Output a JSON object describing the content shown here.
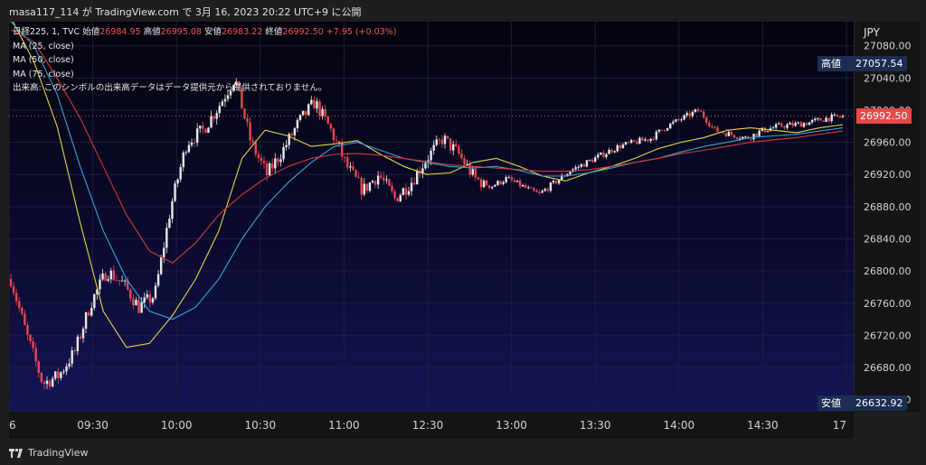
{
  "header": {
    "text": "masa117_114 が TradingView.com で 3月 16, 2023 20:22 UTC+9 に公開"
  },
  "legend": {
    "symbol": "日経225, 1, TVC",
    "open_label": "始値",
    "open_value": "26984.95",
    "high_label": "高値",
    "high_value": "26995.08",
    "low_label": "安値",
    "low_value": "26983.22",
    "close_label": "終値",
    "close_value": "26992.50",
    "change": "+7.95 (+0.03%)",
    "ma25": "MA (25, close)",
    "ma50": "MA (50, close)",
    "ma75": "MA (75, close)",
    "volume_note": "出来高: このシンボルの出来高データはデータ提供元から提供されておりません。"
  },
  "axis": {
    "currency": "JPY",
    "high_tag_label": "高値",
    "high_tag_value": "27057.54",
    "last_price": "26992.50",
    "low_tag_label": "安値",
    "low_tag_value": "26632.92"
  },
  "footer": {
    "brand": "TradingView"
  },
  "colors": {
    "up": "#e8e8e8",
    "down": "#e8484b",
    "ma25": "#e6d34a",
    "ma50": "#35a6d6",
    "ma75": "#d13a3a",
    "last_price_bg": "#e8484b",
    "tag_bg": "#1c2d52"
  },
  "chart_data": {
    "type": "candlestick",
    "yticks": [
      26640,
      26680,
      26720,
      26760,
      26800,
      26840,
      26880,
      26920,
      26960,
      27000,
      27040,
      27080
    ],
    "ylim": [
      26625,
      27110
    ],
    "xticks": [
      "6",
      "09:30",
      "10:00",
      "10:30",
      "11:00",
      "12:30",
      "13:00",
      "13:30",
      "14:00",
      "14:30",
      "17"
    ],
    "series": [
      {
        "name": "MA (25, close)",
        "color": "#e6d34a",
        "values": [
          27115,
          27060,
          26980,
          26860,
          26750,
          26705,
          26710,
          26745,
          26790,
          26850,
          26940,
          26975,
          26968,
          26955,
          26958,
          26962,
          26945,
          26930,
          26920,
          26922,
          26935,
          26940,
          26930,
          26918,
          26912,
          26922,
          26930,
          26940,
          26952,
          26960,
          26966,
          26975,
          26978,
          26975,
          26972,
          26978,
          26982
        ]
      },
      {
        "name": "MA (50, close)",
        "color": "#35a6d6",
        "values": [
          27110,
          27080,
          27020,
          26930,
          26850,
          26790,
          26750,
          26740,
          26755,
          26790,
          26840,
          26880,
          26910,
          26935,
          26955,
          26960,
          26950,
          26940,
          26935,
          26930,
          26928,
          26930,
          26925,
          26918,
          26918,
          26922,
          26928,
          26935,
          26940,
          26948,
          26955,
          26960,
          26966,
          26968,
          26970,
          26974,
          26978
        ]
      },
      {
        "name": "MA (75, close)",
        "color": "#d13a3a",
        "values": [
          27100,
          27085,
          27040,
          26990,
          26930,
          26870,
          26825,
          26810,
          26835,
          26870,
          26895,
          26915,
          26930,
          26940,
          26945,
          26946,
          26944,
          26940,
          26936,
          26932,
          26930,
          26928,
          26926,
          26924,
          26924,
          26926,
          26930,
          26935,
          26940,
          26946,
          26950,
          26955,
          26960,
          26963,
          26966,
          26970,
          26974
        ]
      }
    ],
    "price_path": [
      26790,
      26720,
      26660,
      26670,
      26700,
      26760,
      26800,
      26785,
      26755,
      26770,
      26880,
      26960,
      26975,
      27005,
      27040,
      26960,
      26920,
      26950,
      26985,
      27010,
      26975,
      26930,
      26900,
      26920,
      26890,
      26910,
      26940,
      26965,
      26945,
      26915,
      26905,
      26915,
      26905,
      26895,
      26910,
      26925,
      26935,
      26945,
      26955,
      26960,
      26965,
      26980,
      26990,
      27000,
      26975,
      26970,
      26965,
      26975,
      26980,
      26982,
      26985,
      26990,
      26992
    ]
  }
}
